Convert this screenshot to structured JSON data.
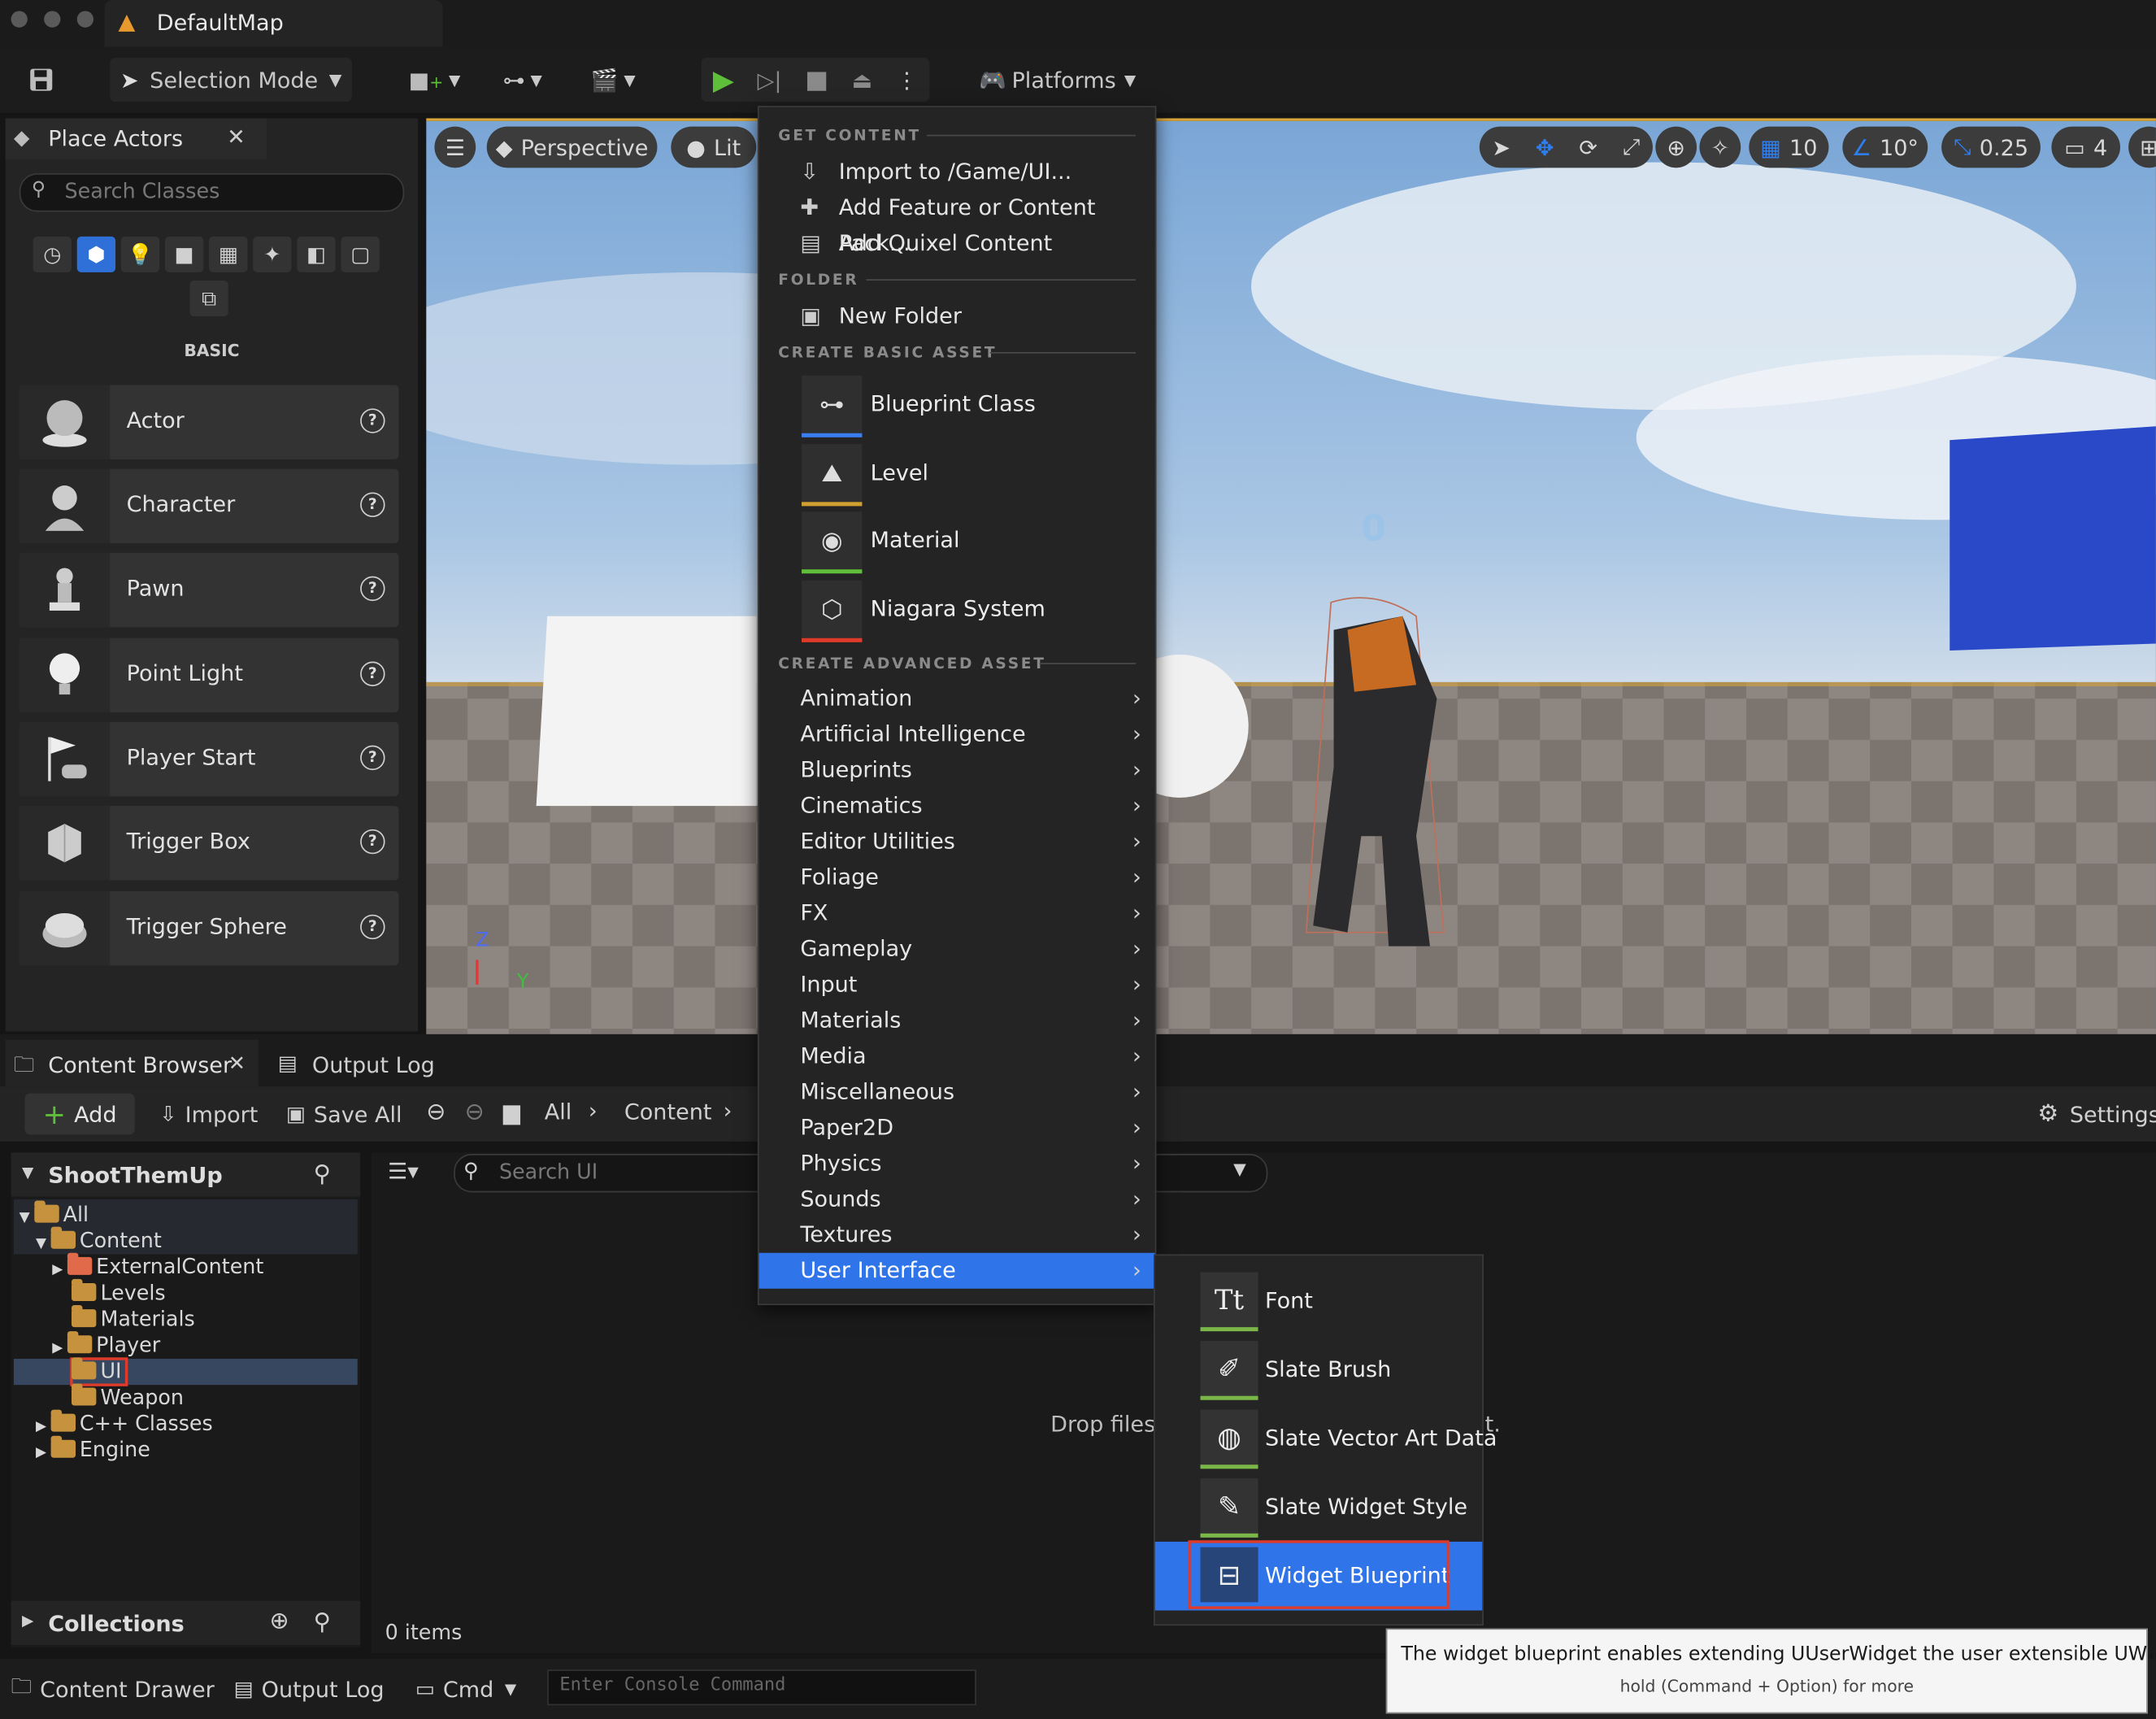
{
  "window": {
    "tab_title": "DefaultMap"
  },
  "toolbar": {
    "selection_mode": "Selection Mode",
    "platforms": "Platforms"
  },
  "place_actors": {
    "tab_label": "Place Actors",
    "search_placeholder": "Search Classes",
    "category_label": "BASIC",
    "actors": [
      "Actor",
      "Character",
      "Pawn",
      "Point Light",
      "Player Start",
      "Trigger Box",
      "Trigger Sphere"
    ]
  },
  "viewport": {
    "perspective": "Perspective",
    "lit": "Lit",
    "grid_snap": "10",
    "rotation_snap": "10°",
    "scale_snap": "0.25",
    "camera_speed": "4",
    "hud_number": "0",
    "axis_z": "Z",
    "axis_y": "Y"
  },
  "context_menu": {
    "section_get_content": "GET CONTENT",
    "import": "Import to /Game/UI...",
    "add_feature": "Add Feature or Content Pack...",
    "add_quixel": "Add Quixel Content",
    "section_folder": "FOLDER",
    "new_folder": "New Folder",
    "section_basic": "CREATE BASIC ASSET",
    "basic_assets": [
      "Blueprint Class",
      "Level",
      "Material",
      "Niagara System"
    ],
    "section_advanced": "CREATE ADVANCED ASSET",
    "advanced_items": [
      "Animation",
      "Artificial Intelligence",
      "Blueprints",
      "Cinematics",
      "Editor Utilities",
      "Foliage",
      "FX",
      "Gameplay",
      "Input",
      "Materials",
      "Media",
      "Miscellaneous",
      "Paper2D",
      "Physics",
      "Sounds",
      "Textures",
      "User Interface"
    ],
    "highlighted": "User Interface"
  },
  "submenu": {
    "items": [
      "Font",
      "Slate Brush",
      "Slate Vector Art Data",
      "Slate Widget Style",
      "Widget Blueprint"
    ],
    "highlighted": "Widget Blueprint"
  },
  "tooltip": {
    "text": "The widget blueprint enables extending UUserWidget the user extensible UWidget.",
    "hint": "hold (Command + Option) for more"
  },
  "content_browser": {
    "tab_label": "Content Browser",
    "output_log_tab": "Output Log",
    "add": "Add",
    "import": "Import",
    "save_all": "Save All",
    "breadcrumb": [
      "All",
      "Content"
    ],
    "settings": "Settings",
    "project": "ShootThemUp",
    "tree": {
      "all": "All",
      "content": "Content",
      "external": "ExternalContent",
      "levels": "Levels",
      "materials": "Materials",
      "player": "Player",
      "ui": "UI",
      "weapon": "Weapon",
      "cpp": "C++ Classes",
      "engine": "Engine"
    },
    "collections": "Collections",
    "search_placeholder": "Search UI",
    "drop_text_left": "Drop files",
    "drop_text_right": "t.",
    "items_count": "0 items"
  },
  "statusbar": {
    "content_drawer": "Content Drawer",
    "output_log": "Output Log",
    "cmd": "Cmd",
    "console_placeholder": "Enter Console Command"
  }
}
